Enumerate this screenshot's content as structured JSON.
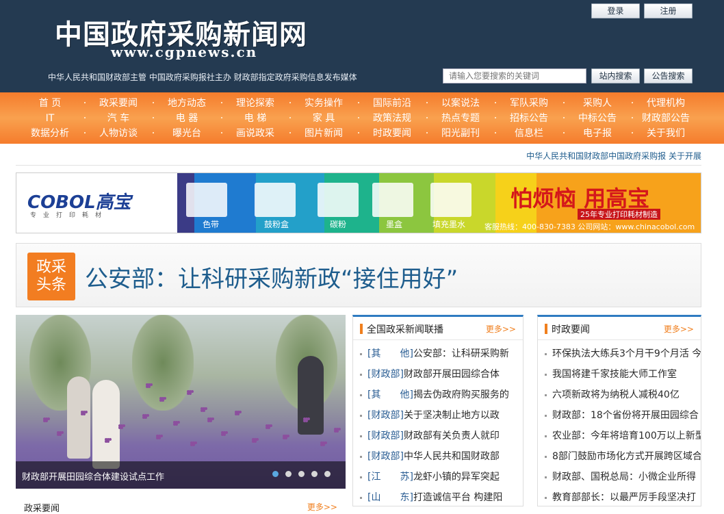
{
  "header": {
    "site_title": "中国政府采购新闻网",
    "site_url": "www.cgpnews.cn",
    "tagline": "中华人民共和国财政部主管  中国政府采购报社主办  财政部指定政府采购信息发布媒体",
    "login_label": "登录",
    "register_label": "注册",
    "search_placeholder": "请输入您要搜索的关键词",
    "site_search_label": "站内搜索",
    "notice_search_label": "公告搜索",
    "bg_color": "#243a51"
  },
  "nav": {
    "items": [
      "首 页",
      "政采要闻",
      "地方动态",
      "理论探索",
      "实务操作",
      "国际前沿",
      "以案说法",
      "军队采购",
      "采购人",
      "代理机构",
      "IT",
      "汽 车",
      "电 器",
      "电 梯",
      "家 具",
      "政策法规",
      "热点专题",
      "招标公告",
      "中标公告",
      "财政部公告",
      "数据分析",
      "人物访谈",
      "曝光台",
      "画说政采",
      "图片新闻",
      "时政要闻",
      "阳光副刊",
      "信息栏",
      "电子报",
      "关于我们"
    ],
    "accent_color": "#f57c2c"
  },
  "announcement": "中华人民共和国财政部中国政府采购报  关于开展",
  "banner": {
    "brand": "COBOL高宝",
    "brand_sub": "专业打印耗材",
    "products": [
      "色带",
      "鼓粉盒",
      "碳粉",
      "墨盒",
      "填充墨水"
    ],
    "slogan": "怕烦恼 用高宝",
    "slogan_sub": "25年专业打印耗材制造",
    "hotline": "客服热线：400-830-7383   公司网站：www.chinacobol.com"
  },
  "headline": {
    "badge_line1": "政采",
    "badge_line2": "头条",
    "title": "公安部：让科研采购新政“接住用好”"
  },
  "slider": {
    "caption": "财政部开展田园综合体建设试点工作",
    "dot_count": 5,
    "active_dot": 1
  },
  "panel_national": {
    "title": "全国政采新闻联播",
    "more": "更多>>",
    "items": [
      {
        "cat": "[其　　他]",
        "text": "公安部：让科研采购新"
      },
      {
        "cat": "[财政部]",
        "text": "财政部开展田园综合体"
      },
      {
        "cat": "[其　　他]",
        "text": "揭去伪政府购买服务的"
      },
      {
        "cat": "[财政部]",
        "text": "关于坚决制止地方以政"
      },
      {
        "cat": "[财政部]",
        "text": "财政部有关负责人就印"
      },
      {
        "cat": "[财政部]",
        "text": "中华人民共和国财政部"
      },
      {
        "cat": "[江　　苏]",
        "text": "龙虾小镇的异军突起"
      },
      {
        "cat": "[山　　东]",
        "text": "打造诚信平台 构建阳"
      }
    ]
  },
  "panel_politics": {
    "title": "时政要闻",
    "more": "更多>>",
    "items": [
      "环保执法大练兵3个月干9个月活 今",
      "我国将建千家技能大师工作室",
      "六项新政将为纳税人减税40亿",
      "财政部：18个省份将开展田园综合",
      "农业部：今年将培育100万以上新型",
      "8部门鼓励市场化方式开展跨区域合",
      "财政部、国税总局：小微企业所得",
      "教育部部长：以最严厉手段坚决打"
    ]
  },
  "bottom_section": {
    "title": "政采要闻",
    "more": "更多>>"
  }
}
